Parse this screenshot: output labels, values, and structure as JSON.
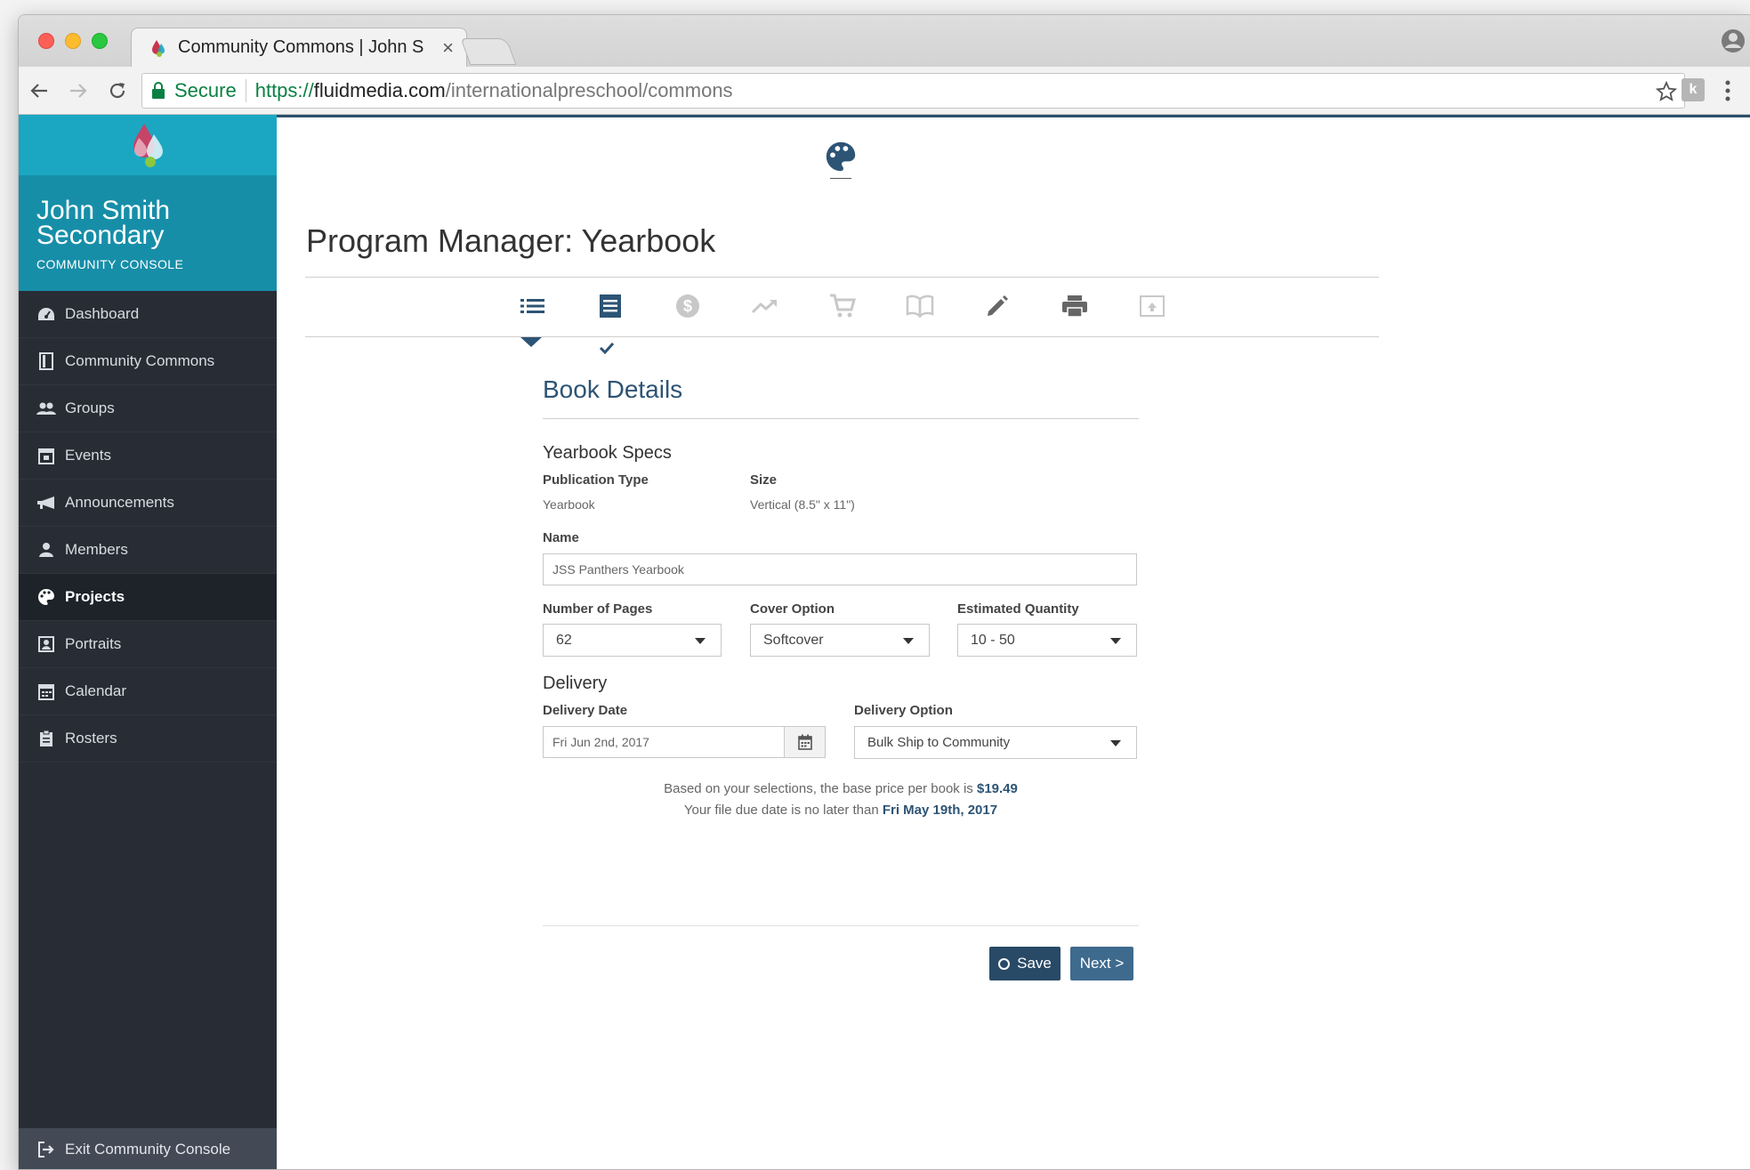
{
  "browser": {
    "tab_title": "Community Commons | John S",
    "tab_close": "×",
    "secure_label": "Secure",
    "url_scheme": "https://",
    "url_host": "fluidmedia.com",
    "url_path": "/internationalpreschool/commons",
    "extension_label": "k"
  },
  "sidebar": {
    "org_name_line1": "John Smith",
    "org_name_line2": "Secondary",
    "org_subtitle": "COMMUNITY CONSOLE",
    "items": [
      {
        "label": "Dashboard",
        "icon": "dashboard-icon"
      },
      {
        "label": "Community Commons",
        "icon": "book-icon"
      },
      {
        "label": "Groups",
        "icon": "people-icon"
      },
      {
        "label": "Events",
        "icon": "calendar-day-icon"
      },
      {
        "label": "Announcements",
        "icon": "megaphone-icon"
      },
      {
        "label": "Members",
        "icon": "person-icon"
      },
      {
        "label": "Projects",
        "icon": "palette-icon",
        "active": true
      },
      {
        "label": "Portraits",
        "icon": "portrait-icon"
      },
      {
        "label": "Calendar",
        "icon": "calendar-icon"
      },
      {
        "label": "Rosters",
        "icon": "clipboard-icon"
      }
    ],
    "exit_label": "Exit Community Console"
  },
  "main": {
    "page_title": "Program Manager: Yearbook",
    "steps": [
      "list-icon",
      "document-icon",
      "dollar-icon",
      "trending-icon",
      "cart-icon",
      "open-book-icon",
      "pencil-icon",
      "printer-icon",
      "upload-icon"
    ],
    "active_step": 0,
    "completed_step": 1
  },
  "form": {
    "section_title": "Book Details",
    "specs_title": "Yearbook Specs",
    "publication_type_label": "Publication Type",
    "publication_type_value": "Yearbook",
    "size_label": "Size",
    "size_value": "Vertical (8.5\" x 11\")",
    "name_label": "Name",
    "name_value": "JSS Panthers Yearbook",
    "pages_label": "Number of Pages",
    "pages_value": "62",
    "cover_label": "Cover Option",
    "cover_value": "Softcover",
    "quantity_label": "Estimated Quantity",
    "quantity_value": "10 - 50",
    "delivery_title": "Delivery",
    "delivery_date_label": "Delivery Date",
    "delivery_date_value": "Fri Jun 2nd, 2017",
    "delivery_option_label": "Delivery Option",
    "delivery_option_value": "Bulk Ship to Community",
    "price_text": "Based on your selections, the base price per book is ",
    "price_value": "$19.49",
    "due_text": "Your file due date is no later than ",
    "due_value": "Fri May 19th, 2017",
    "save_label": "Save",
    "next_label": "Next >"
  },
  "colors": {
    "brand_teal": "#1ba7c2",
    "brand_navy": "#2d5475",
    "sidebar_bg": "#282d35"
  }
}
